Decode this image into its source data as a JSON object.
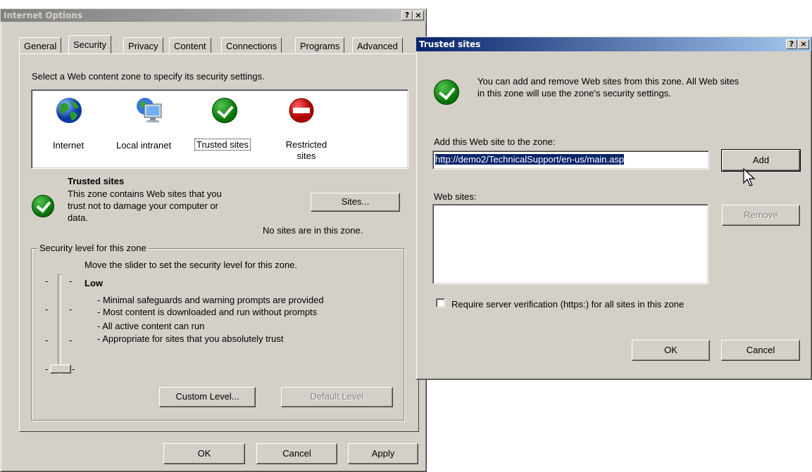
{
  "internet_options": {
    "title": "Internet Options",
    "title_help": "?",
    "title_close": "×",
    "tabs": [
      "General",
      "Security",
      "Privacy",
      "Content",
      "Connections",
      "Programs",
      "Advanced"
    ],
    "select_zone_text": "Select a Web content zone to specify its security settings.",
    "zones": [
      {
        "label": "Internet",
        "icon": "globe-icon"
      },
      {
        "label": "Local intranet",
        "icon": "intranet-computer-icon"
      },
      {
        "label": "Trusted sites",
        "icon": "trusted-check-icon"
      },
      {
        "label": "Restricted sites",
        "icon": "restricted-no-entry-icon"
      }
    ],
    "zone_info": {
      "heading": "Trusted sites",
      "line1": "This zone contains Web sites that you",
      "line2": "trust not to damage your computer or",
      "line3": "data.",
      "sites_button": "Sites...",
      "no_sites": "No sites are in this zone."
    },
    "security_level": {
      "legend": "Security level for this zone",
      "instruction": "Move the slider to set the security level for this zone.",
      "level": "Low",
      "bullets": [
        "- Minimal safeguards and warning prompts are provided",
        "- Most content is downloaded and run without prompts",
        "- All active content can run",
        "- Appropriate for sites that you absolutely trust"
      ],
      "custom_button": "Custom Level...",
      "default_button": "Default Level"
    },
    "buttons": {
      "ok": "OK",
      "cancel": "Cancel",
      "apply": "Apply"
    }
  },
  "trusted_sites": {
    "title": "Trusted sites",
    "title_help": "?",
    "title_close": "×",
    "description_line1": "You can add and remove Web sites from this zone. All Web sites",
    "description_line2": "in this zone will use the zone's security settings.",
    "add_label": "Add this Web site to the zone:",
    "url_value": "http://demo2/TechnicalSupport/en-us/main.asp",
    "add_button": "Add",
    "websites_label": "Web sites:",
    "remove_button": "Remove",
    "require_https_label": "Require server verification (https:) for all sites in this zone",
    "require_https_checked": false,
    "ok_button": "OK",
    "cancel_button": "Cancel"
  },
  "colors": {
    "face": "#d4d0c8",
    "active_title": "#0a246a",
    "selection": "#0a246a",
    "trusted_green": "#0a7a0a",
    "restricted_red": "#d40000"
  }
}
